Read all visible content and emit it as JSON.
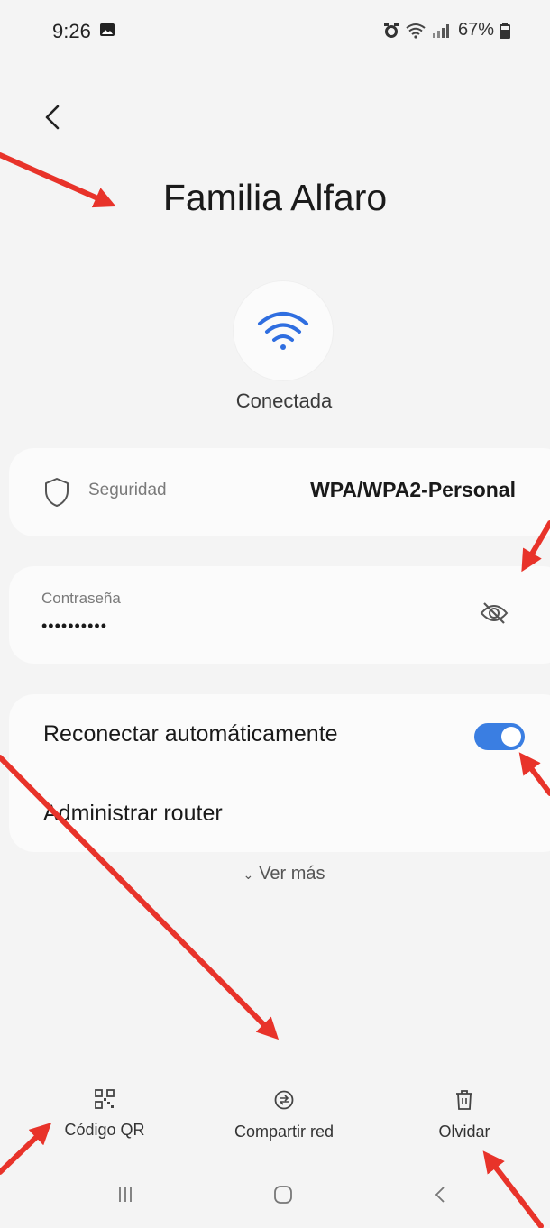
{
  "status_bar": {
    "time": "9:26",
    "battery": "67%"
  },
  "icons": {
    "back": "chevron-left-icon",
    "wifi": "wifi-icon",
    "security": "shield-icon",
    "password_visibility": "eye-off-icon",
    "qr": "qr-code-icon",
    "share": "share-network-icon",
    "forget": "trash-icon"
  },
  "network": {
    "name": "Familia Alfaro",
    "status": "Conectada"
  },
  "security": {
    "label": "Seguridad",
    "value": "WPA/WPA2-Personal"
  },
  "password": {
    "label": "Contraseña",
    "value": "••••••••••"
  },
  "options": {
    "auto_reconnect_label": "Reconectar automáticamente",
    "auto_reconnect_on": true,
    "manage_router_label": "Administrar router"
  },
  "see_more": "Ver más",
  "actions": {
    "qr": "Código QR",
    "share": "Compartir red",
    "forget": "Olvidar"
  },
  "colors": {
    "accent": "#3a7ee2",
    "annotation": "#e8332a",
    "background": "#f4f4f4"
  }
}
